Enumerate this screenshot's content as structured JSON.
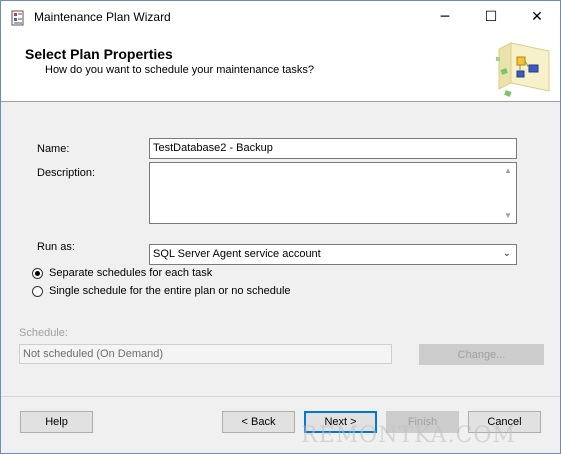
{
  "window": {
    "title": "Maintenance Plan Wizard",
    "minimize": "─",
    "maximize": "☐",
    "close": "✕"
  },
  "header": {
    "title": "Select Plan Properties",
    "subtitle": "How do you want to schedule your maintenance tasks?"
  },
  "form": {
    "name_label": "Name:",
    "name_value": "TestDatabase2 - Backup",
    "description_label": "Description:",
    "description_value": "",
    "runas_label": "Run as:",
    "runas_value": "SQL Server Agent service account",
    "radio_separate": "Separate schedules for each task",
    "radio_single": "Single schedule for the entire plan or no schedule",
    "selected_option": "separate",
    "schedule_label": "Schedule:",
    "schedule_value": "Not scheduled (On Demand)",
    "change_button": "Change..."
  },
  "footer": {
    "help": "Help",
    "back": "< Back",
    "next": "Next >",
    "finish": "Finish",
    "cancel": "Cancel"
  },
  "watermark": "REMONTKA.COM",
  "colors": {
    "accent": "#0078d7",
    "border": "#7a7a7a",
    "disabled_text": "#a0a0a0"
  }
}
